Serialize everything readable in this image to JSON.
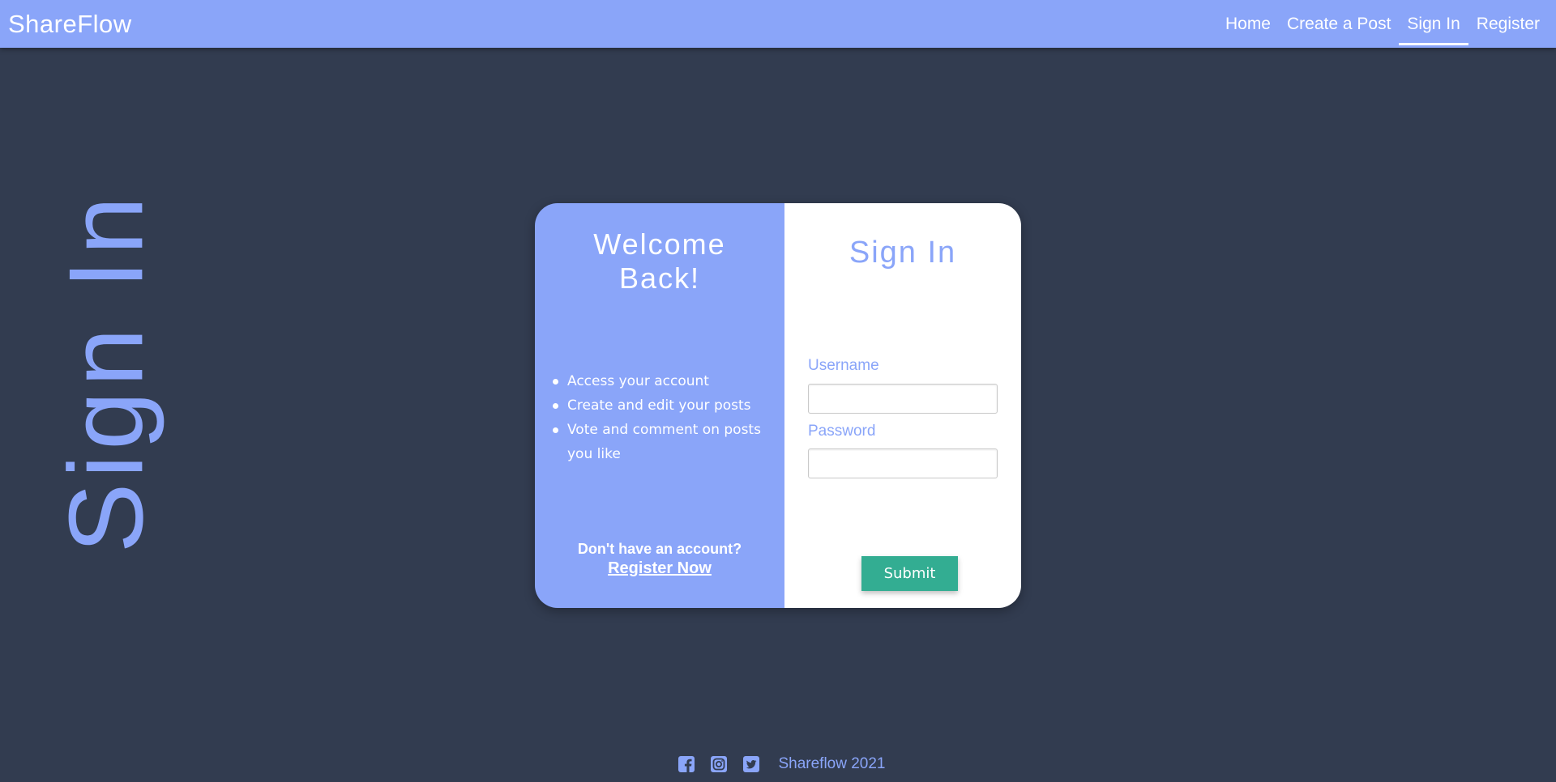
{
  "navbar": {
    "brand": "ShareFlow",
    "links": [
      {
        "label": "Home"
      },
      {
        "label": "Create a Post"
      },
      {
        "label": "Sign In",
        "active": true
      },
      {
        "label": "Register"
      }
    ]
  },
  "side_title": "Sign In",
  "card": {
    "left": {
      "welcome": "Welcome Back!",
      "benefits": [
        "Access your account",
        "Create and edit your posts",
        "Vote and comment on posts you like"
      ],
      "register_question": "Don't have an account?",
      "register_link": "Register Now"
    },
    "right": {
      "title": "Sign In",
      "username_label": "Username",
      "username_value": "",
      "password_label": "Password",
      "password_value": "",
      "submit_label": "Submit"
    }
  },
  "footer": {
    "icons": [
      "facebook-icon",
      "instagram-icon",
      "twitter-icon"
    ],
    "copyright": "Shareflow 2021"
  },
  "colors": {
    "background": "#323c50",
    "accent": "#8aa5f9",
    "submit": "#33ad92",
    "white": "#ffffff"
  }
}
